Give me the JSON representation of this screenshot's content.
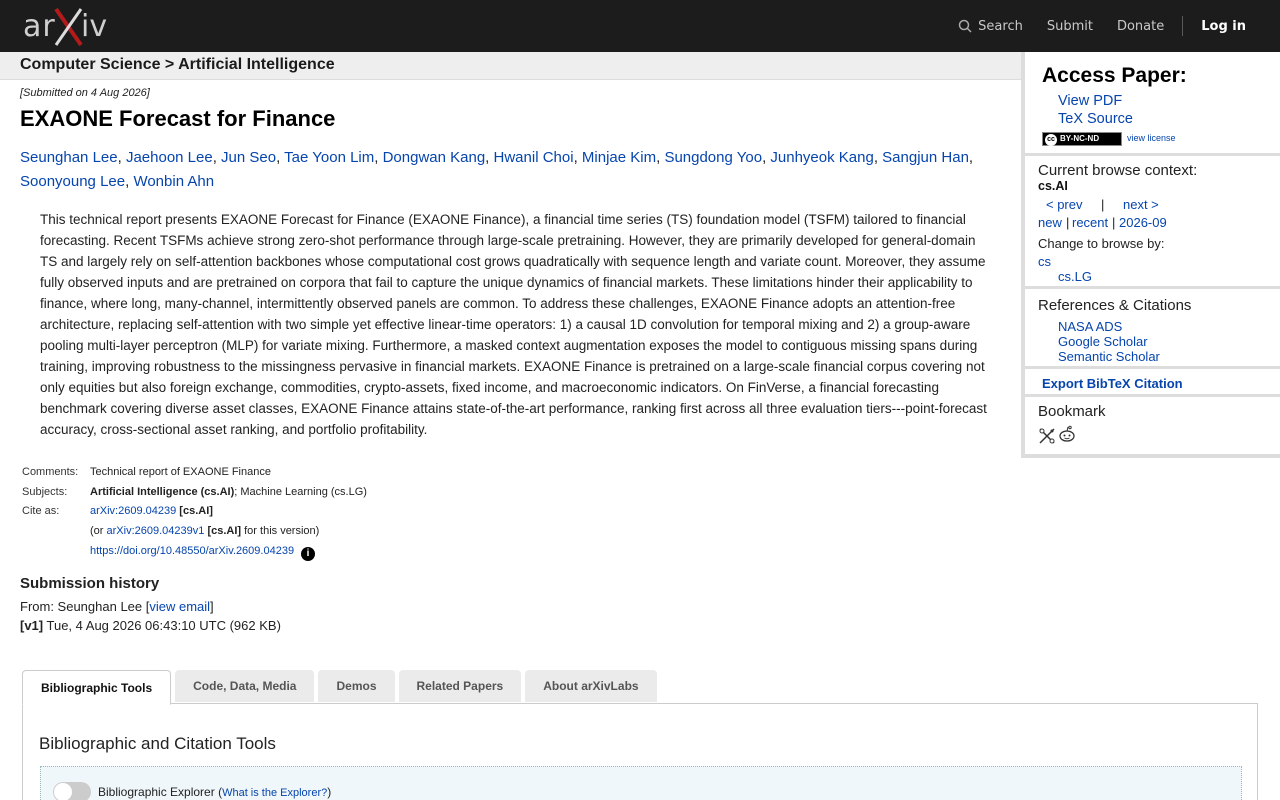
{
  "header": {
    "logo": "arXiv",
    "nav": [
      {
        "label": "Search",
        "icon": "search-icon"
      },
      {
        "label": "Submit"
      },
      {
        "label": "Donate"
      }
    ],
    "login": "Log in"
  },
  "breadcrumb": "Computer Science > Artificial Intelligence",
  "submitted": "[Submitted on 4 Aug 2026]",
  "paper": {
    "title": "EXAONE Forecast for Finance",
    "authors": [
      "Seunghan Lee",
      "Jaehoon Lee",
      "Jun Seo",
      "Tae Yoon Lim",
      "Dongwan Kang",
      "Hwanil Choi",
      "Minjae Kim",
      "Sungdong Yoo",
      "Junhyeok Kang",
      "Sangjun Han",
      "Soonyoung Lee",
      "Wonbin Ahn"
    ],
    "abstract": "This technical report presents EXAONE Forecast for Finance (EXAONE Finance), a financial time series (TS) foundation model (TSFM) tailored to financial forecasting. Recent TSFMs achieve strong zero-shot performance through large-scale pretraining. However, they are primarily developed for general-domain TS and largely rely on self-attention backbones whose computational cost grows quadratically with sequence length and variate count. Moreover, they assume fully observed inputs and are pretrained on corpora that fail to capture the unique dynamics of financial markets. These limitations hinder their applicability to finance, where long, many-channel, intermittently observed panels are common. To address these challenges, EXAONE Finance adopts an attention-free architecture, replacing self-attention with two simple yet effective linear-time operators: 1) a causal 1D convolution for temporal mixing and 2) a group-aware pooling multi-layer perceptron (MLP) for variate mixing. Furthermore, a masked context augmentation exposes the model to contiguous missing spans during training, improving robustness to the missingness pervasive in financial markets. EXAONE Finance is pretrained on a large-scale financial corpus covering not only equities but also foreign exchange, commodities, crypto-assets, fixed income, and macroeconomic indicators. On FinVerse, a financial forecasting benchmark covering diverse asset classes, EXAONE Finance attains state-of-the-art performance, ranking first across all three evaluation tiers---point-forecast accuracy, cross-sectional asset ranking, and portfolio profitability."
  },
  "meta": {
    "comments_label": "Comments:",
    "comments": "Technical report of EXAONE Finance",
    "subjects_label": "Subjects:",
    "subject_primary": "Artificial Intelligence (cs.AI)",
    "subject_rest": "; Machine Learning (cs.LG)",
    "cite_label": "Cite as:",
    "cite_id": "arXiv:2609.04239",
    "cite_cat": "[cs.AI]",
    "cite_or": "(or",
    "cite_version": "arXiv:2609.04239v1",
    "cite_suffix": "for this version)",
    "doi": "https://doi.org/10.48550/arXiv.2609.04239"
  },
  "history": {
    "heading": "Submission history",
    "from_prefix": "From: Seunghan Lee [",
    "view_email": "view email",
    "from_suffix": "]",
    "v1_label": "[v1]",
    "v1_text": "Tue, 4 Aug 2026 06:43:10 UTC (962 KB)"
  },
  "tabs": [
    "Bibliographic Tools",
    "Code, Data, Media",
    "Demos",
    "Related Papers",
    "About arXivLabs"
  ],
  "tools": {
    "heading": "Bibliographic and Citation Tools",
    "explorer_label": "Bibliographic Explorer",
    "explorer_link": "What is the Explorer?"
  },
  "sidebar": {
    "access_heading": "Access Paper:",
    "view_pdf": "View PDF",
    "tex_source": "TeX Source",
    "license_badge": "BY-NC-ND",
    "view_license": "view license",
    "context_heading": "Current browse context:",
    "context": "cs.AI",
    "prev": "< prev",
    "pipe": "|",
    "next": "next >",
    "new": "new",
    "recent": "recent",
    "month": "2026-09",
    "change_label": "Change to browse by:",
    "browse_cs": "cs",
    "browse_lg": "cs.LG",
    "refs_heading": "References & Citations",
    "nasa": "NASA ADS",
    "google": "Google Scholar",
    "semantic": "Semantic Scholar",
    "export": "Export BibTeX Citation",
    "bookmark_heading": "Bookmark"
  },
  "colors": {
    "header_bg": "#1c1c1c",
    "link": "#0645ad",
    "logo_accent": "#b31b1b"
  }
}
